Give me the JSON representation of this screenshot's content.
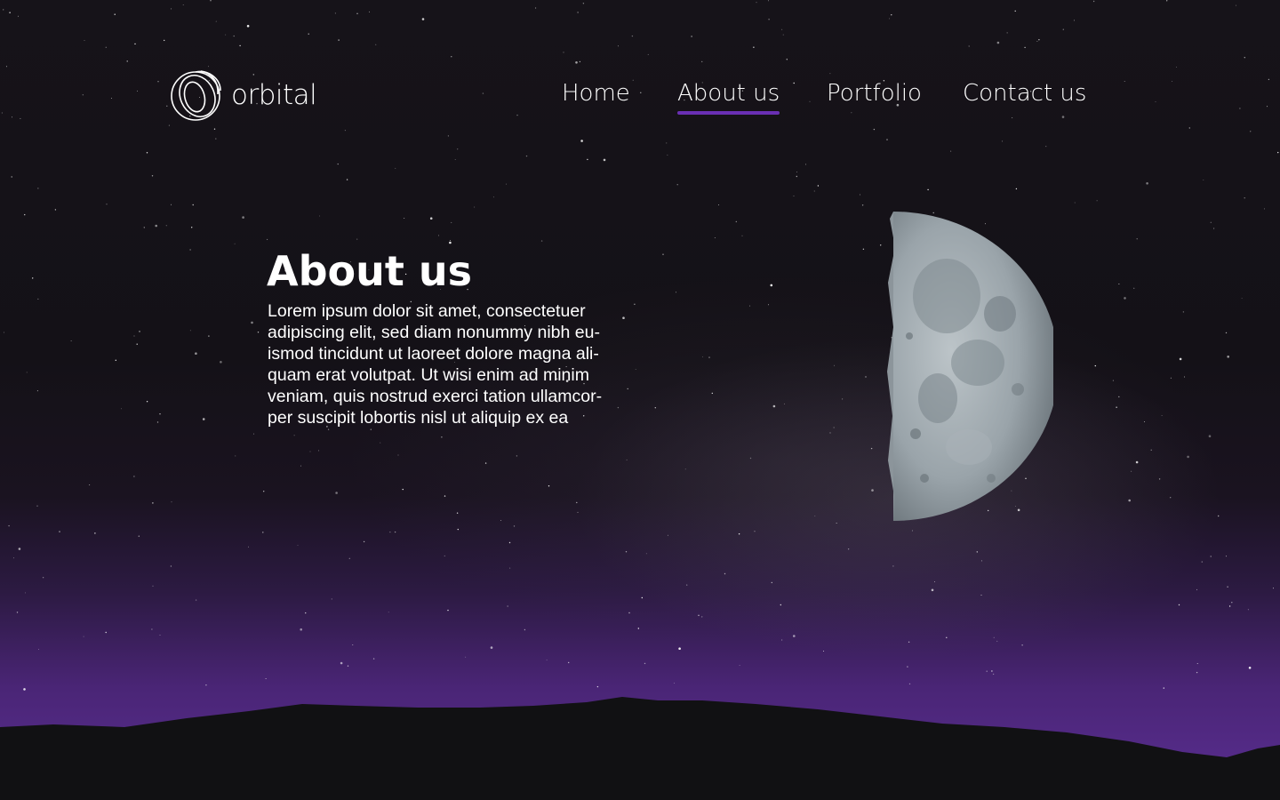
{
  "brand": {
    "name": "orbital",
    "logo_icon": "orbital-swirl-logo"
  },
  "nav": {
    "items": [
      {
        "label": "Home",
        "active": false
      },
      {
        "label": "About us",
        "active": true
      },
      {
        "label": "Portfolio",
        "active": false
      },
      {
        "label": "Contact us",
        "active": false
      }
    ]
  },
  "about": {
    "title": "About us",
    "body": "Lorem ipsum dolor sit amet, consectetuer adipiscing elit, sed diam nonummy nibh eu-ismod tincidunt ut laoreet dolore magna ali-quam erat volutpat. Ut wisi enim ad minim veniam, quis nostrud exerci tation ullamcor-per suscipit lobortis nisl ut aliquip ex ea"
  },
  "colors": {
    "accent": "#6a2fb4",
    "sky_dark": "#141117",
    "horizon_purple": "#5a2e92",
    "hills": "#111113",
    "text": "#ffffff"
  }
}
